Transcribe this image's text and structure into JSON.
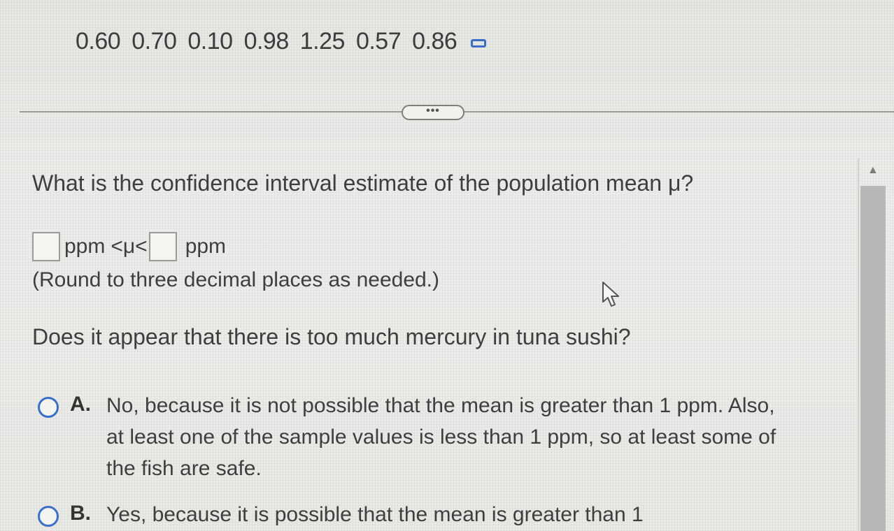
{
  "sample_values": [
    "0.60",
    "0.70",
    "0.10",
    "0.98",
    "1.25",
    "0.57",
    "0.86"
  ],
  "copy_icon": "copy-icon",
  "expand_label": "•••",
  "question": "What is the confidence interval estimate of the population mean μ?",
  "interval": {
    "lower_value": "",
    "lower_unit": "ppm",
    "middle": "<μ<",
    "upper_value": "",
    "upper_unit": "ppm"
  },
  "round_note": "(Round to three decimal places as needed.)",
  "question2": "Does it appear that there is too much mercury in tuna sushi?",
  "options": [
    {
      "letter": "A.",
      "text": "No, because it is not possible that the mean is greater than 1 ppm. Also, at least one of the sample values is less than 1 ppm, so at least some of the fish are safe."
    },
    {
      "letter": "B.",
      "text": "Yes, because it is possible that the mean is greater than 1"
    }
  ],
  "colors": {
    "accent": "#3b6fc7",
    "text": "#3e3e3e",
    "background": "#e9e9e6"
  }
}
